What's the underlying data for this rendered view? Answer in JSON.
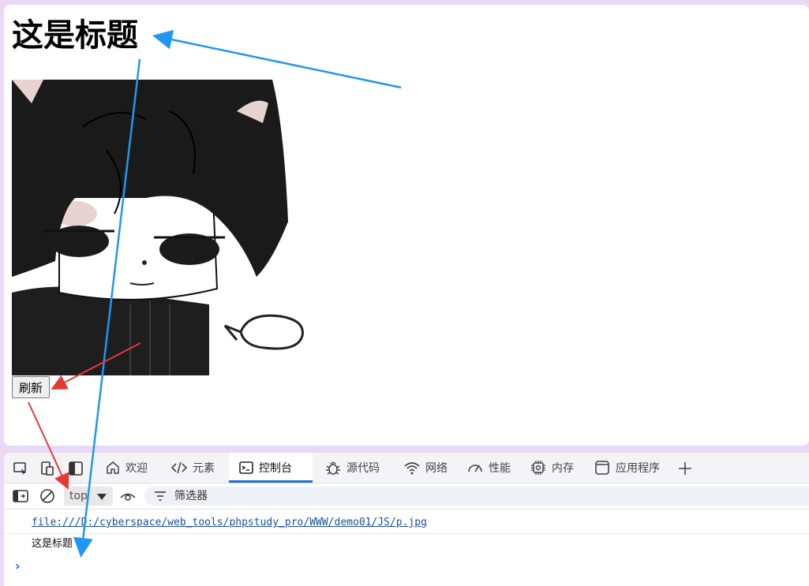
{
  "page": {
    "heading": "这是标题",
    "refresh_button_label": "刷新"
  },
  "devtools": {
    "tabs": [
      {
        "label": "欢迎",
        "icon": "home-icon"
      },
      {
        "label": "元素",
        "icon": "code-icon"
      },
      {
        "label": "控制台",
        "icon": "console-icon",
        "active": true
      },
      {
        "label": "源代码",
        "icon": "bug-icon"
      },
      {
        "label": "网络",
        "icon": "wifi-icon"
      },
      {
        "label": "性能",
        "icon": "gauge-icon"
      },
      {
        "label": "内存",
        "icon": "chip-icon"
      },
      {
        "label": "应用程序",
        "icon": "app-window-icon"
      }
    ],
    "toolbar": {
      "context": "top",
      "filter_placeholder": "筛选器"
    },
    "console": {
      "lines": [
        {
          "type": "link",
          "text": "file:///D:/cyberspace/web_tools/phpstudy_pro/WWW/demo01/JS/p.jpg"
        },
        {
          "type": "log",
          "text": "这是标题"
        }
      ],
      "prompt": "›"
    }
  },
  "colors": {
    "accent": "#1a6fd1",
    "annotation_blue": "#2196f3",
    "annotation_red": "#e53935"
  }
}
